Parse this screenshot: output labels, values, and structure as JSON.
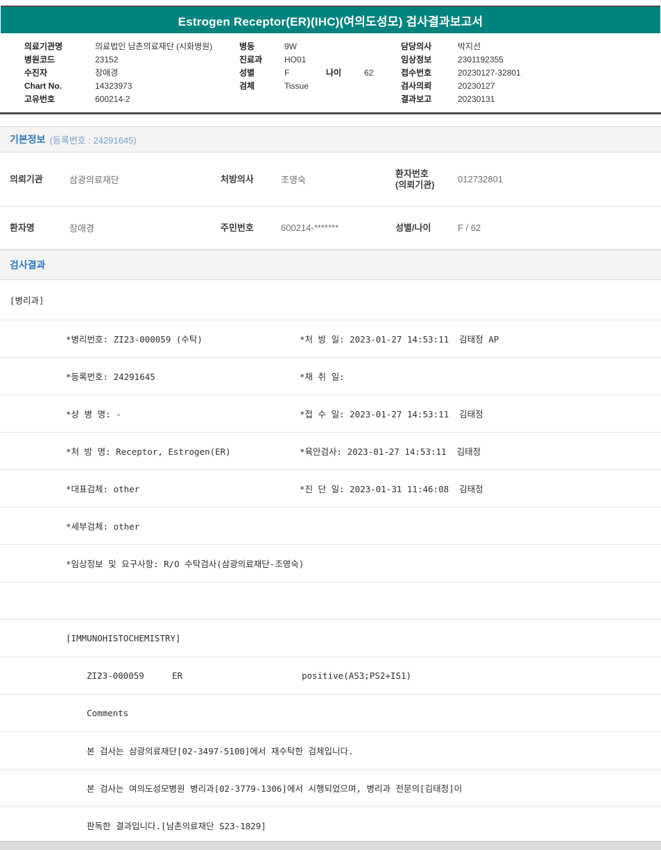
{
  "title": "Estrogen Receptor(ER)(IHC)(여의도성모) 검사결과보고서",
  "patient_header": {
    "left": [
      {
        "label": "의료기관명",
        "value": "의료법인 남촌의료재단 (시화병원)"
      },
      {
        "label": "병원코드",
        "value": "23152"
      },
      {
        "label": "수진자",
        "value": "장애경"
      },
      {
        "label": "Chart No.",
        "value": "14323973"
      },
      {
        "label": "고유번호",
        "value": "600214-2"
      }
    ],
    "mid": [
      {
        "label": "병동",
        "value": "9W"
      },
      {
        "label": "진료과",
        "value": "HO01"
      },
      {
        "label": "성별",
        "value": "F"
      },
      {
        "label": "검체",
        "value": "Tissue"
      }
    ],
    "age": {
      "label": "나이",
      "value": "62"
    },
    "right": [
      {
        "label": "담당의사",
        "value": "박지선"
      },
      {
        "label": "임상정보",
        "value": "2301192355"
      },
      {
        "label": "접수번호",
        "value": "20230127-32801"
      },
      {
        "label": "검사의뢰",
        "value": "20230127"
      },
      {
        "label": "결과보고",
        "value": "20230131"
      }
    ]
  },
  "basic_info": {
    "title": "기본정보",
    "subtitle": "(등록번호 : 24291645)",
    "row1": {
      "c1_label": "의뢰기관",
      "c1_value": "삼광의료재단",
      "c2_label": "처방의사",
      "c2_value": "조영숙",
      "c3_label_line1": "환자번호",
      "c3_label_line2": "(의뢰기관)",
      "c3_value": "012732801"
    },
    "row2": {
      "c1_label": "환자명",
      "c1_value": "장애경",
      "c2_label": "주민번호",
      "c2_value": "600214-*******",
      "c3_label": "성별/나이",
      "c3_value": "F / 62"
    }
  },
  "results": {
    "title": "검사결과",
    "department": "[병리과]",
    "rows": [
      {
        "left": "*병리번호: ZI23-000059 (수탁)",
        "right": "*처 방 일: 2023-01-27 14:53:11  김태정 AP"
      },
      {
        "left": "*등록번호: 24291645",
        "right": "*채 취 일:"
      },
      {
        "left": "*상 병 명: -",
        "right": "*접 수 일: 2023-01-27 14:53:11  김태정"
      },
      {
        "left": "*처 방 명: Receptor, Estrogen(ER)",
        "right": "*육안검사: 2023-01-27 14:53:11  김태정"
      },
      {
        "left": "*대표검체: other",
        "right": "*진 단 일: 2023-01-31 11:46:08  김태정"
      },
      {
        "left": "*세부검체: other",
        "right": ""
      },
      {
        "left": "*임상정보 및 요구사항: R/O 수탁검사(삼광의료재단-조영숙)",
        "right": ""
      },
      {
        "left": "",
        "right": ""
      }
    ],
    "ihc": {
      "section": "[IMMUNOHISTOCHEMISTRY]",
      "specimen_no": "ZI23-000059",
      "test_name": "ER",
      "result": "positive(AS3;PS2+IS1)",
      "comments_label": "Comments",
      "comment_lines": [
        "본 검사는 삼광의료재단[02-3497-5100]에서 재수탁한 검체입니다.",
        "본 검사는 여의도성모병원 병리과[02-3779-1306]에서 시행되었으며, 병리과 전문의[김태정]이",
        "판독한 결과입니다.[남촌의료재단 S23-1829]"
      ]
    }
  },
  "colors": {
    "title_bar_bg": "#00837e",
    "title_bar_text": "#ffffff",
    "section_title_text": "#3279b7",
    "section_bar_bg": "#f4f4f4",
    "divider_dark": "#4a4a4a",
    "row_border": "#e6e6e6",
    "bottom_bar_bg": "#dcdcdc"
  }
}
